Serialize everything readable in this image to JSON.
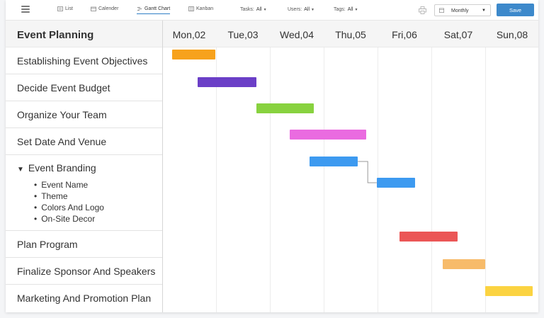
{
  "toolbar": {
    "views": [
      {
        "label": "List",
        "icon": "list-icon"
      },
      {
        "label": "Calender",
        "icon": "calendar-icon"
      },
      {
        "label": "Gantt Chart",
        "icon": "gantt-icon",
        "active": true
      },
      {
        "label": "Kanban",
        "icon": "kanban-icon"
      }
    ],
    "filters": [
      {
        "label": "Tasks:",
        "value": "All"
      },
      {
        "label": "Users:",
        "value": "All"
      },
      {
        "label": "Tags:",
        "value": "All"
      }
    ],
    "scale": {
      "selected": "Monthly"
    },
    "save_label": "Save"
  },
  "project": {
    "title": "Event Planning"
  },
  "timeline": {
    "days": [
      "Mon,02",
      "Tue,03",
      "Wed,04",
      "Thu,05",
      "Fri,06",
      "Sat,07",
      "Sun,08"
    ]
  },
  "tasks": [
    {
      "label": "Establishing Event Objectives",
      "color": "#f7a21d",
      "start": 0.0,
      "end": 0.8
    },
    {
      "label": "Decide Event Budget",
      "color": "#6b3fc7",
      "start": 0.47,
      "end": 1.56
    },
    {
      "label": "Organize Your Team",
      "color": "#88d23f",
      "start": 1.56,
      "end": 2.63
    },
    {
      "label": "Set Date And Venue",
      "color": "#ea6be0",
      "start": 2.18,
      "end": 3.6
    },
    {
      "label": "Event Branding",
      "expanded": true,
      "subtasks": [
        "Event Name",
        "Theme",
        "Colors And Logo",
        "On-Site Decor"
      ],
      "bars": [
        {
          "color": "#3d9af0",
          "start": 2.55,
          "end": 3.45
        },
        {
          "color": "#3d9af0",
          "start": 3.8,
          "end": 4.51
        }
      ]
    },
    {
      "label": "Plan Program",
      "color": "#eb5656",
      "start": 4.23,
      "end": 5.3
    },
    {
      "label": "Finalize Sponsor And Speakers",
      "color": "#f7bb6a",
      "start": 5.03,
      "end": 5.81
    },
    {
      "label": "Marketing And Promotion Plan",
      "color": "#fbd341",
      "start": 5.81,
      "end": 6.7
    }
  ],
  "colors": {
    "accent": "#3d89cb",
    "link_line": "#9a9a9a"
  }
}
